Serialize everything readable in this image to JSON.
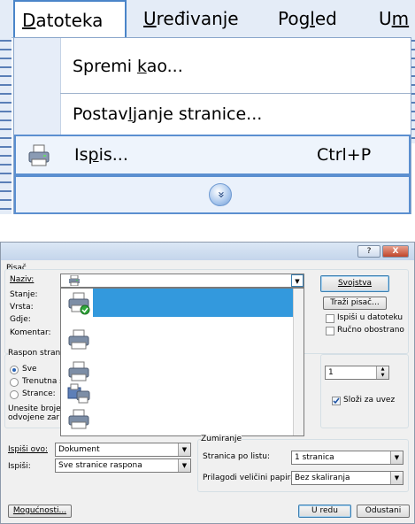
{
  "menu": {
    "bar_items": [
      {
        "pre": "",
        "ul": "D",
        "post": "atoteka"
      },
      {
        "pre": "",
        "ul": "U",
        "post": "ređivanje"
      },
      {
        "pre": "Pog",
        "ul": "l",
        "post": "ed"
      },
      {
        "pre": "U",
        "ul": "m",
        "post": ""
      }
    ],
    "dropdown": {
      "save_as": {
        "pre": "Spremi ",
        "ul": "k",
        "post": "ao..."
      },
      "page_setup": {
        "pre": "Postav",
        "ul": "l",
        "post": "janje stranice..."
      },
      "print": {
        "pre": "Is",
        "ul": "p",
        "post": "is...",
        "shortcut": "Ctrl+P"
      },
      "expand_glyph": "»"
    }
  },
  "dialog": {
    "title_buttons": {
      "help": "?",
      "close": "X"
    },
    "printer_group": "Pisač",
    "name_label": "Naziv:",
    "status_label": "Stanje:",
    "type_label": "Vrsta:",
    "where_label": "Gdje:",
    "comment_label": "Komentar:",
    "properties_button": "Svojstva",
    "find_printer_button": "Traži pisač...",
    "print_to_file": "Ispiši u datoteku",
    "manual_duplex": "Ručno obostrano",
    "range_group": "Raspon strani",
    "range_all": "Sve",
    "range_current": "Trenutna s",
    "range_pages": "Strance:",
    "range_hint_1": "Unesite broje",
    "range_hint_2": "odvojene zar",
    "copies_value": "1",
    "collate": "Složi za uvez",
    "print_what_label": "Ispiši ovo:",
    "print_what_value": "Dokument",
    "print_label": "Ispiši:",
    "print_value": "Sve stranice raspona",
    "zoom_group": "Zumiranje",
    "pages_per_sheet_label": "Stranica po listu:",
    "pages_per_sheet_value": "1 stranica",
    "scale_label": "Prilagodi veličini papira",
    "scale_value": "Bez skaliranja",
    "options_button": "Mogućnosti...",
    "ok_button": "U redu",
    "cancel_button": "Odustani"
  },
  "colors": {
    "selection": "#3399dd",
    "menu_border": "#5b8fd0"
  }
}
